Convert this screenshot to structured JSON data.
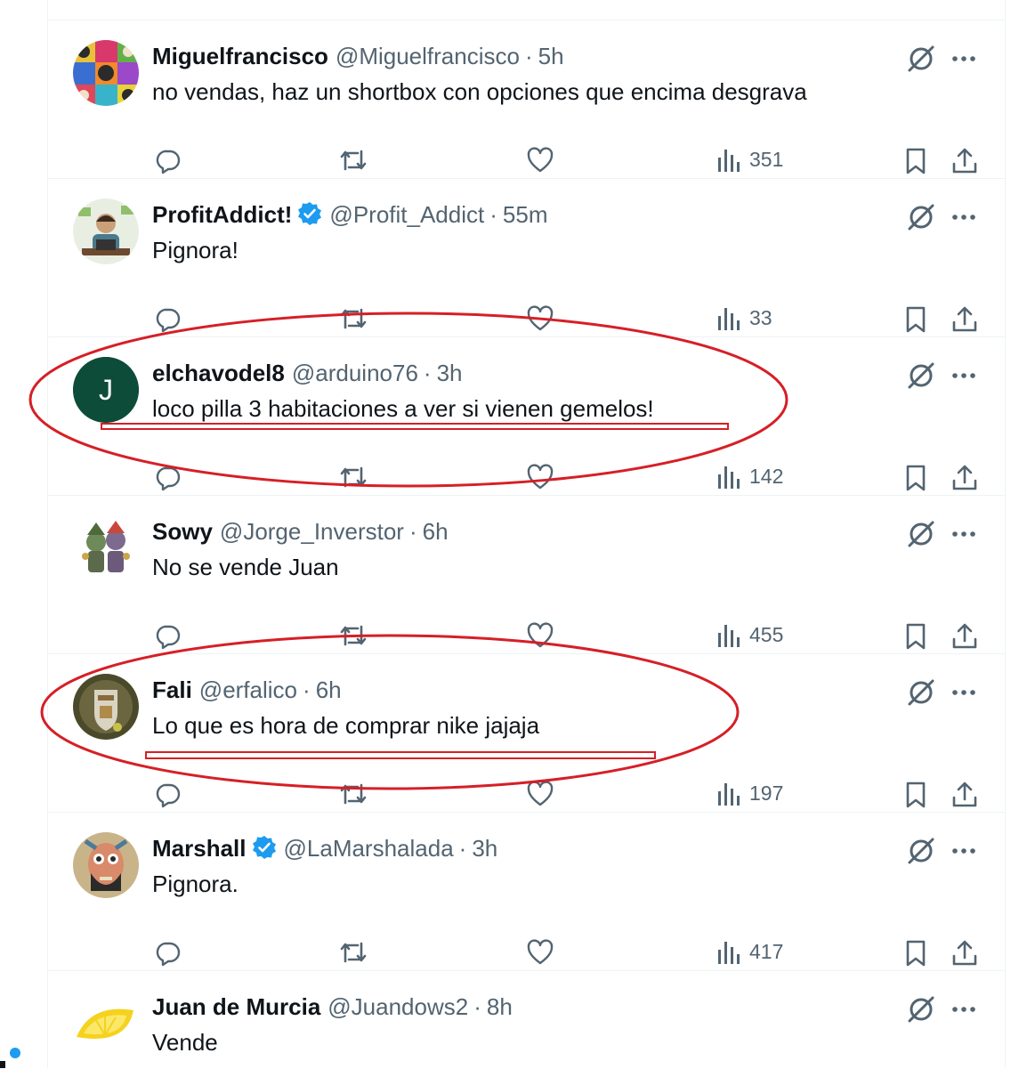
{
  "tweets": [
    {
      "name": "Miguelfrancisco",
      "verified": false,
      "handle": "@Miguelfrancisco",
      "sep": "·",
      "time": "5h",
      "text": "no vendas, haz un shortbox con opciones que encima desgrava",
      "views": "351",
      "avatar": "pop-art-grid"
    },
    {
      "name": "ProfitAddict!",
      "verified": true,
      "handle": "@Profit_Addict",
      "sep": "·",
      "time": "55m",
      "text": "Pignora!",
      "views": "33",
      "avatar": "cartoon-trader"
    },
    {
      "name": "elchavodel8",
      "verified": false,
      "handle": "@arduino76",
      "sep": "·",
      "time": "3h",
      "text": "loco pilla 3 habitaciones a ver si vienen gemelos!",
      "views": "142",
      "avatar": "letter",
      "avatar_letter": "J",
      "avatar_color": "#0e4c3a"
    },
    {
      "name": "Sowy",
      "verified": false,
      "handle": "@Jorge_Inverstor",
      "sep": "·",
      "time": "6h",
      "text": "No se vende Juan",
      "views": "455",
      "avatar": "goblins"
    },
    {
      "name": "Fali",
      "verified": false,
      "handle": "@erfalico",
      "sep": "·",
      "time": "6h",
      "text": "Lo que es hora de comprar nike jajaja",
      "views": "197",
      "avatar": "crest"
    },
    {
      "name": "Marshall",
      "verified": true,
      "handle": "@LaMarshalada",
      "sep": "·",
      "time": "3h",
      "text": "Pignora.",
      "views": "417",
      "avatar": "painted-face"
    },
    {
      "name": "Juan de Murcia",
      "verified": false,
      "handle": "@Juandows2",
      "sep": "·",
      "time": "8h",
      "text": "Vende",
      "views": "",
      "avatar": "lemon"
    }
  ],
  "icons": {
    "reply": "reply-icon",
    "retweet": "retweet-icon",
    "like": "heart-icon",
    "views": "views-icon",
    "bookmark": "bookmark-icon",
    "share": "share-icon",
    "grok": "grok-icon",
    "more": "more-icon",
    "verified": "verified-badge-icon"
  },
  "colors": {
    "text_primary": "#0f1419",
    "text_secondary": "#536471",
    "verified": "#1d9bf0",
    "annotation": "#d61f26",
    "divider": "#eff3f4"
  }
}
